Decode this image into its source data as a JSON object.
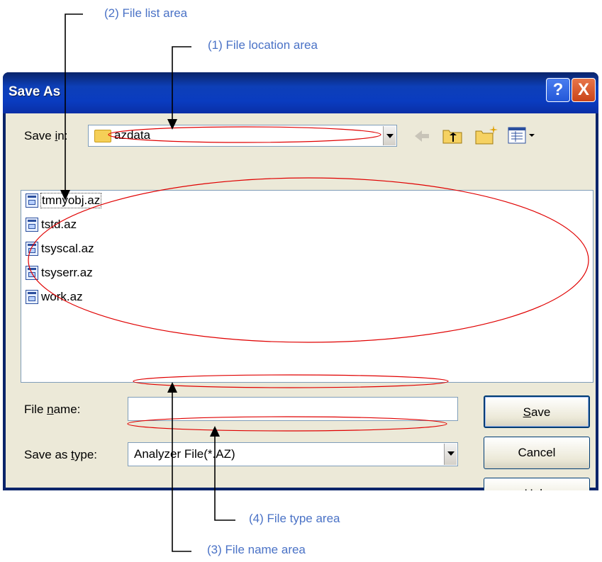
{
  "annotations": {
    "file_list": "(2) File list area",
    "file_location": "(1) File location area",
    "file_type": "(4) File type area",
    "file_name": "(3) File name area"
  },
  "dialog": {
    "title": "Save As",
    "help_glyph": "?",
    "close_glyph": "X",
    "save_in_label_pre": "Save ",
    "save_in_label_key": "i",
    "save_in_label_post": "n:",
    "save_in_value": "azdata",
    "toolbar_icons": [
      "back-arrow-icon",
      "up-one-level-icon",
      "new-folder-icon",
      "view-menu-icon"
    ],
    "files": [
      "tmnyobj.az",
      "tstd.az",
      "tsyscal.az",
      "tsyserr.az",
      "work.az"
    ],
    "file_name_label_pre": "File ",
    "file_name_label_key": "n",
    "file_name_label_post": "ame:",
    "file_name_value": "",
    "save_as_type_label_pre": "Save as ",
    "save_as_type_label_key": "t",
    "save_as_type_label_post": "ype:",
    "save_as_type_value": "Analyzer File(*.AZ)",
    "save_button_key": "S",
    "save_button_rest": "ave",
    "cancel_button": "Cancel",
    "help_button_key": "H",
    "help_button_rest": "elp"
  },
  "colors": {
    "callout_text": "#4a72c6",
    "annotation_ellipse": "#e00000",
    "titlebar": "#0a3cc0",
    "dialog_face": "#ece9d8"
  }
}
